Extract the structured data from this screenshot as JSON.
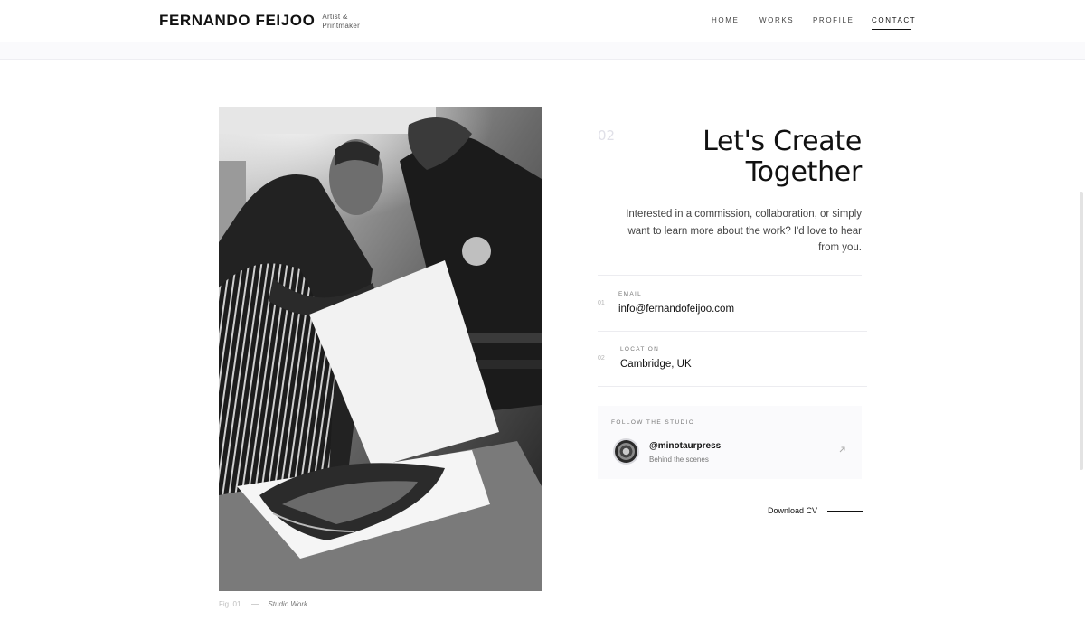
{
  "header": {
    "brand_name": "FERNANDO FEIJOO",
    "brand_tagline": "Artist & Printmaker",
    "nav": [
      {
        "label": "HOME",
        "active": false
      },
      {
        "label": "WORKS",
        "active": false
      },
      {
        "label": "PROFILE",
        "active": false
      },
      {
        "label": "CONTACT",
        "active": true
      }
    ]
  },
  "figure": {
    "fig_label": "Fig. 01",
    "title": "Studio Work"
  },
  "contact": {
    "section_number": "02",
    "headline_line1": "Let's Create",
    "headline_line2": "Together",
    "intro": "Interested in a commission, collaboration, or simply want to learn more about the work? I'd love to hear from you.",
    "items": [
      {
        "index": "01",
        "label": "EMAIL",
        "value": "info@fernandofeijoo.com"
      },
      {
        "index": "02",
        "label": "LOCATION",
        "value": "Cambridge, UK"
      }
    ],
    "social": {
      "heading": "FOLLOW THE STUDIO",
      "handle": "@minotaurpress",
      "subtitle": "Behind the scenes",
      "icon": "arrow-up-right-icon"
    },
    "cv_label": "Download CV"
  },
  "colors": {
    "text": "#111111",
    "muted": "#777777",
    "card_bg": "#fafafc",
    "divider": "#ececf0"
  }
}
